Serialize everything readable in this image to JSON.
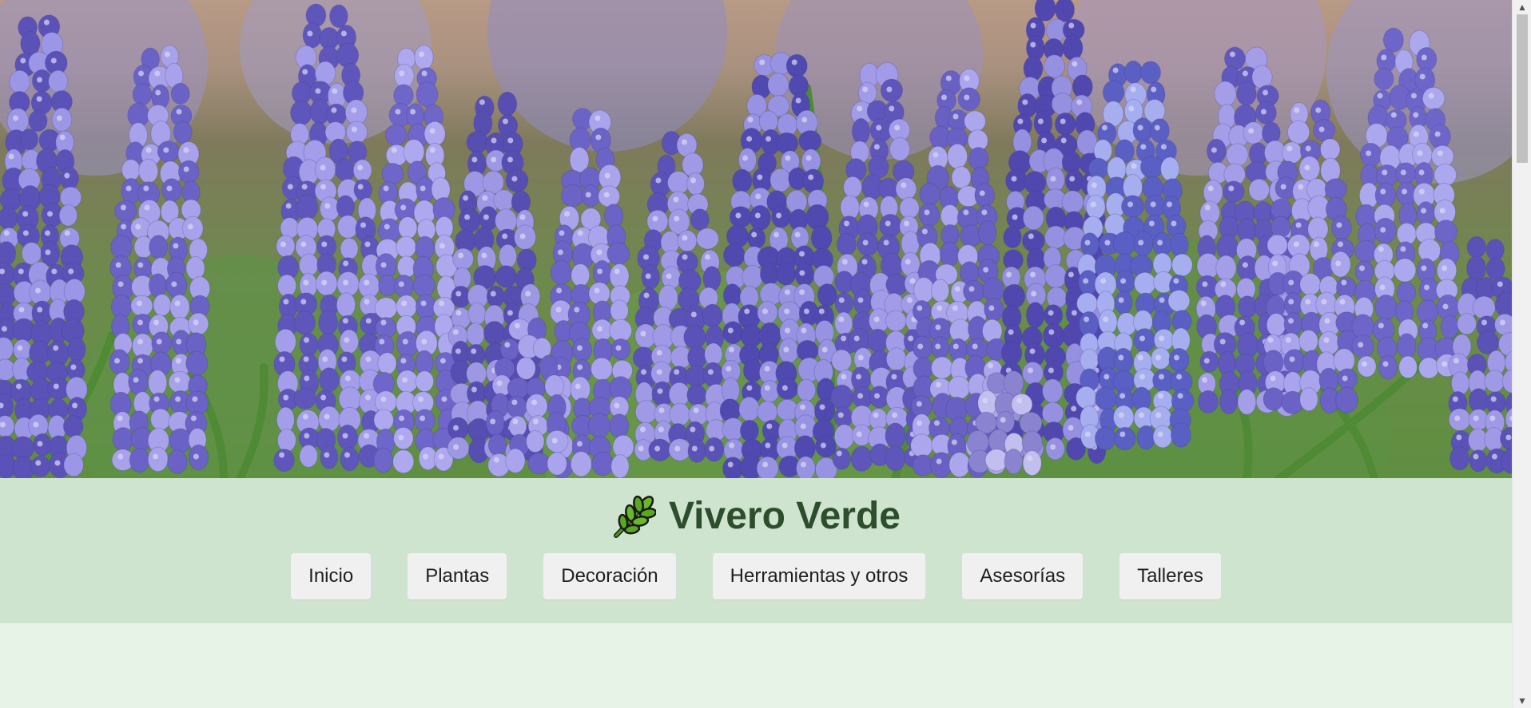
{
  "hero": {
    "image_alt": "purple grape hyacinth flowers"
  },
  "header": {
    "logo_icon": "leaf-branch-icon",
    "title": "Vivero Verde"
  },
  "nav": {
    "items": [
      {
        "label": "Inicio"
      },
      {
        "label": "Plantas"
      },
      {
        "label": "Decoración"
      },
      {
        "label": "Herramientas y otros"
      },
      {
        "label": "Asesorías"
      },
      {
        "label": "Talleres"
      }
    ]
  },
  "scrollbar": {
    "up_icon": "chevron-up-icon",
    "down_icon": "chevron-down-icon"
  },
  "colors": {
    "header_bg": "#cfe4cf",
    "page_bg": "#e8f3e8",
    "title": "#2d4e2d",
    "button_bg": "#f0f0f0"
  }
}
